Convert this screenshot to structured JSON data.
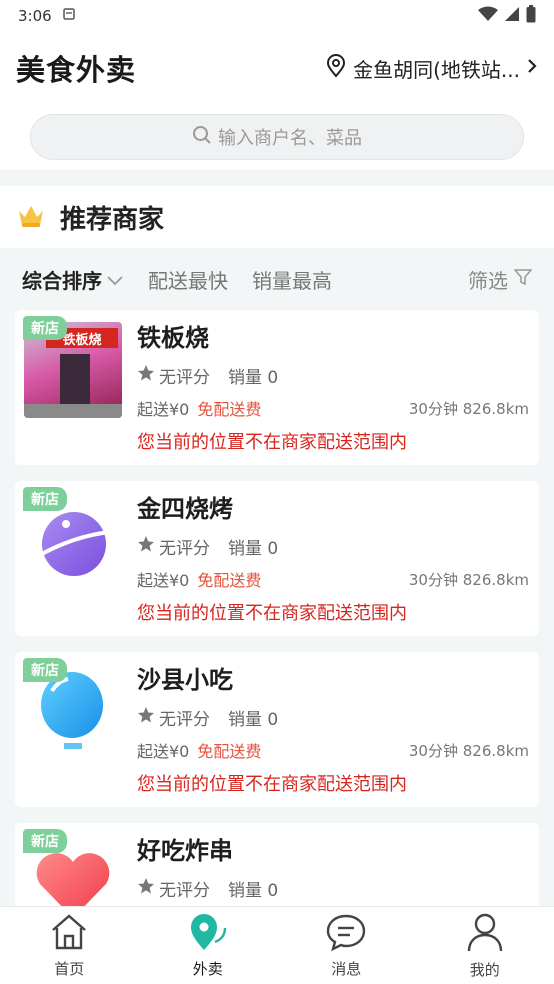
{
  "status": {
    "time": "3:06"
  },
  "header": {
    "title": "美食外卖",
    "location": "金鱼胡同(地铁站..."
  },
  "search": {
    "placeholder": "输入商户名、菜品"
  },
  "recommend": {
    "title": "推荐商家"
  },
  "sort": {
    "items": [
      "综合排序",
      "配送最快",
      "销量最高"
    ],
    "filter": "筛选"
  },
  "shops": [
    {
      "badge": "新店",
      "name": "铁板烧",
      "rating": "无评分",
      "sales": "销量 0",
      "min_order": "起送¥0",
      "free_delivery": "免配送费",
      "eta": "30分钟 826.8km",
      "warning": "您当前的位置不在商家配送范围内",
      "photo_sign": "铁板烧"
    },
    {
      "badge": "新店",
      "name": "金四烧烤",
      "rating": "无评分",
      "sales": "销量 0",
      "min_order": "起送¥0",
      "free_delivery": "免配送费",
      "eta": "30分钟 826.8km",
      "warning": "您当前的位置不在商家配送范围内"
    },
    {
      "badge": "新店",
      "name": "沙县小吃",
      "rating": "无评分",
      "sales": "销量 0",
      "min_order": "起送¥0",
      "free_delivery": "免配送费",
      "eta": "30分钟 826.8km",
      "warning": "您当前的位置不在商家配送范围内"
    },
    {
      "badge": "新店",
      "name": "好吃炸串",
      "rating": "无评分",
      "sales": "销量 0"
    }
  ],
  "nav": [
    {
      "label": "首页",
      "icon": "home-icon"
    },
    {
      "label": "外卖",
      "icon": "takeout-icon"
    },
    {
      "label": "消息",
      "icon": "message-icon"
    },
    {
      "label": "我的",
      "icon": "profile-icon"
    }
  ],
  "colors": {
    "accent": "#1fb8a3",
    "warning": "#d8251d",
    "free": "#e5533d",
    "badge": "#7fcf9a"
  }
}
